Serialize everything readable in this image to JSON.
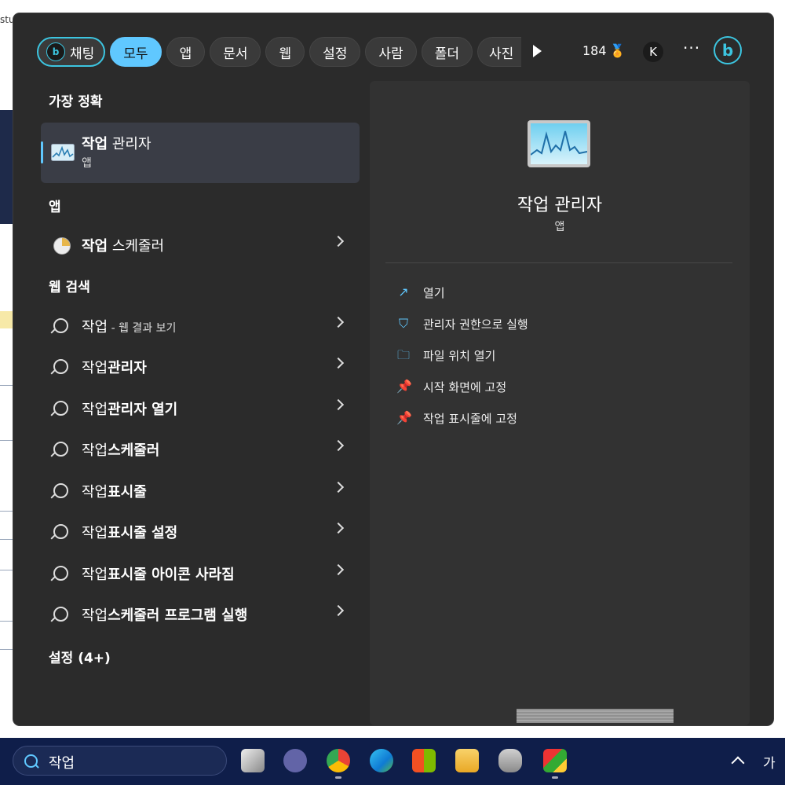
{
  "background": {
    "fragment": "stu"
  },
  "filters": [
    {
      "label": "채팅"
    },
    {
      "label": "모두"
    },
    {
      "label": "앱"
    },
    {
      "label": "문서"
    },
    {
      "label": "웹"
    },
    {
      "label": "설정"
    },
    {
      "label": "사람"
    },
    {
      "label": "폴더"
    },
    {
      "label": "사진"
    }
  ],
  "header": {
    "points": "184",
    "avatar": "K",
    "more": "···"
  },
  "sections": {
    "best": "가장 정확",
    "apps": "앱",
    "web": "웹 검색",
    "settings": "설정 (4+)"
  },
  "best_match": {
    "bold": "작업",
    "rest": " 관리자",
    "type": "앱"
  },
  "apps": [
    {
      "bold": "작업",
      "rest": " 스케줄러"
    }
  ],
  "web_results": [
    {
      "normal": "작업",
      "bold": "",
      "small": " - 웹 결과 보기"
    },
    {
      "normal": "작업",
      "bold": "관리자",
      "small": ""
    },
    {
      "normal": "작업",
      "bold": "관리자 열기",
      "small": ""
    },
    {
      "normal": "작업",
      "bold": "스케줄러",
      "small": ""
    },
    {
      "normal": "작업",
      "bold": "표시줄",
      "small": ""
    },
    {
      "normal": "작업",
      "bold": "표시줄 설정",
      "small": ""
    },
    {
      "normal": "작업",
      "bold": "표시줄 아이콘 사라짐",
      "small": ""
    },
    {
      "normal": "작업",
      "bold": "스케줄러 프로그램 실행",
      "small": ""
    }
  ],
  "detail": {
    "name": "작업 관리자",
    "type": "앱",
    "actions": [
      {
        "label": "열기",
        "icon": "open-external-icon"
      },
      {
        "label": "관리자 권한으로 실행",
        "icon": "shield-admin-icon"
      },
      {
        "label": "파일 위치 열기",
        "icon": "folder-icon"
      },
      {
        "label": "시작 화면에 고정",
        "icon": "pin-icon"
      },
      {
        "label": "작업 표시줄에 고정",
        "icon": "pin-icon"
      }
    ]
  },
  "taskbar": {
    "search_value": "작업",
    "ime": "가"
  },
  "colors": {
    "accent": "#60c8ff",
    "bing": "#3cc5e0",
    "panel": "#2b2b2b",
    "taskbar": "#0f1e4a"
  }
}
